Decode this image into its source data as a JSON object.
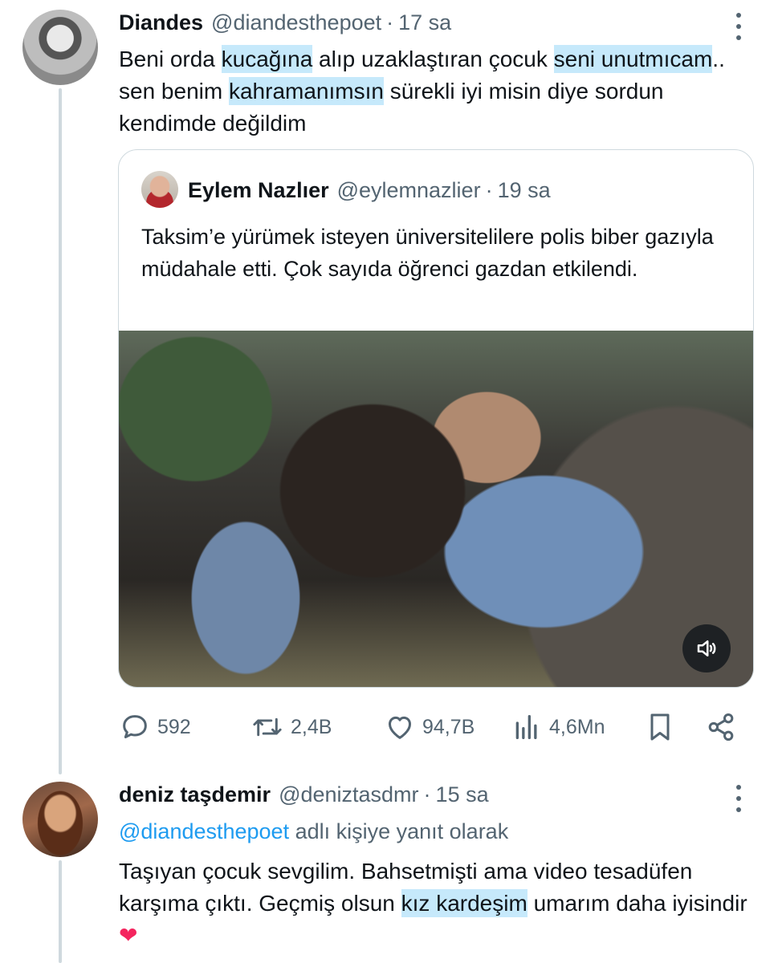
{
  "tweet1": {
    "name": "Diandes",
    "handle": "@diandesthepoet",
    "separator": "·",
    "time": "17 sa",
    "text": {
      "p1": "Beni orda ",
      "h1": "kucağına",
      "p2": " alıp uzaklaştıran çocuk ",
      "h2": "seni unutmıcam",
      "p3": ".. sen benim ",
      "h3": "kahramanımsın",
      "p4": " sürekli iyi misin diye sordun kendimde değildim"
    },
    "quote": {
      "name": "Eylem Nazlıer",
      "handle": "@eylemnazlier",
      "separator": "·",
      "time": "19 sa",
      "text": "Taksim’e yürümek isteyen üniversitelilere polis biber gazıyla müdahale etti. Çok sayıda öğrenci gazdan etkilendi.",
      "media_icon": "speaker-icon"
    },
    "actions": {
      "replies": "592",
      "retweets": "2,4B",
      "likes": "94,7B",
      "views": "4,6Mn"
    }
  },
  "tweet2": {
    "name": "deniz taşdemir",
    "handle": "@deniztasdmr",
    "separator": "·",
    "time": "15 sa",
    "reply_mention": "@diandesthepoet",
    "reply_suffix": " adlı kişiye yanıt olarak",
    "text": {
      "p1": "Taşıyan çocuk sevgilim. Bahsetmişti ama video tesadüfen karşıma çıktı. Geçmiş olsun ",
      "h1": "kız kardeşim",
      "p2": " umarım daha iyisindir ",
      "emoji": "❤"
    }
  },
  "colors": {
    "text": "#0f1419",
    "secondary": "#536471",
    "link": "#1d9bf0",
    "highlight": "#c6e9fb",
    "border": "#cfd9de"
  }
}
